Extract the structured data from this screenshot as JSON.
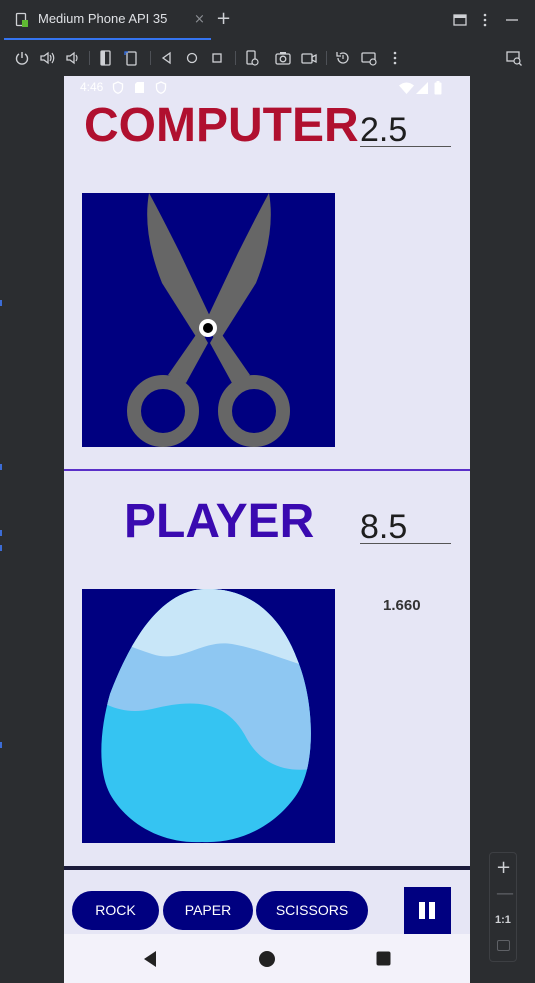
{
  "ide": {
    "tab_title": "Medium Phone API 35",
    "tab_close": "×",
    "add_tab": "+"
  },
  "device": {
    "status_time": "4:46"
  },
  "game": {
    "computer_label": "COMPUTER",
    "computer_score": "2.5",
    "computer_choice_icon": "scissors-icon",
    "player_label": "PLAYER",
    "player_score": "8.5",
    "player_choice_icon": "rock-icon",
    "timer": "1.660",
    "buttons": {
      "rock": "ROCK",
      "paper": "PAPER",
      "scissors": "SCISSORS"
    }
  },
  "zoom": {
    "plus": "+",
    "minus": "—",
    "one_to_one": "1:1"
  },
  "colors": {
    "computer_title": "#b0102f",
    "player_title": "#3a0ab0",
    "image_background": "#000080",
    "button_background": "#000080",
    "screen_background": "#e6e6f5",
    "ide_accent": "#3574f0"
  }
}
